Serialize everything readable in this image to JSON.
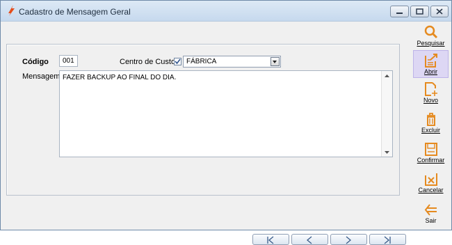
{
  "window": {
    "title": "Cadastro de Mensagem Geral"
  },
  "form": {
    "codigo_label": "Código",
    "codigo_value": "001",
    "centro_label": "Centro de Custo",
    "centro_checked": true,
    "centro_value": "FÁBRICA",
    "mensagem_label": "Mensagem",
    "mensagem_value": "FAZER BACKUP AO FINAL DO DIA."
  },
  "toolbar": {
    "pesquisar": "Pesquisar",
    "abrir": "Abrir",
    "novo": "Novo",
    "excluir": "Excluir",
    "confirmar": "Confirmar",
    "cancelar": "Cancelar",
    "sair": "Sair"
  },
  "colors": {
    "accent_orange": "#e58a1f",
    "active_bg": "#ddd7f4"
  }
}
